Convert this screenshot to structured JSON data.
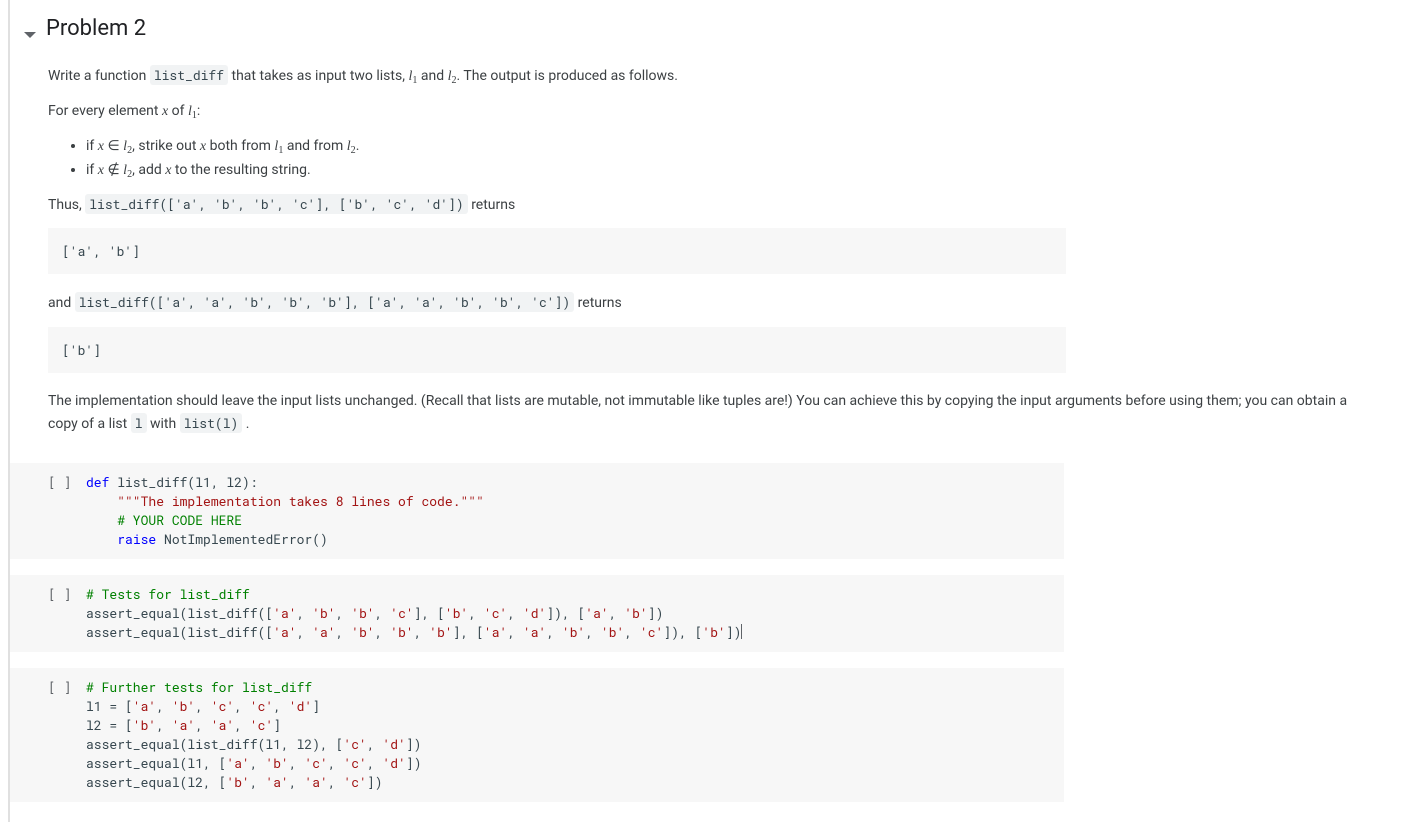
{
  "heading": "Problem 2",
  "para1_pre": "Write a function ",
  "para1_code": "list_diff",
  "para1_mid": " that takes as input two lists, ",
  "para1_l1": "l",
  "para1_l1_sub": "1",
  "para1_and": " and ",
  "para1_l2": "l",
  "para1_l2_sub": "2",
  "para1_end": ". The output is produced as follows.",
  "para2_pre": "For every element ",
  "para2_x": "x",
  "para2_mid": " of ",
  "para2_l1": "l",
  "para2_l1_sub": "1",
  "para2_end": ":",
  "li1_pre": "if ",
  "li1_x": "x",
  "li1_in": " ∈ ",
  "li1_l2": "l",
  "li1_l2_sub": "2",
  "li1_mid": ", strike out ",
  "li1_x2": "x",
  "li1_from": " both from ",
  "li1_l1": "l",
  "li1_l1_sub": "1",
  "li1_and": " and from ",
  "li1_l2b": "l",
  "li1_l2b_sub": "2",
  "li1_end": ".",
  "li2_pre": "if ",
  "li2_x": "x",
  "li2_nin": " ∉ ",
  "li2_l2": "l",
  "li2_l2_sub": "2",
  "li2_mid": ", add ",
  "li2_x2": "x",
  "li2_end": " to the resulting string.",
  "para3_pre": "Thus, ",
  "para3_code": "list_diff(['a', 'b', 'b', 'c'], ['b', 'c', 'd'])",
  "para3_end": " returns",
  "codeblock1": "['a', 'b']",
  "para4_pre": "and ",
  "para4_code": "list_diff(['a', 'a', 'b', 'b', 'b'], ['a', 'a', 'b', 'b', 'c'])",
  "para4_end": " returns",
  "codeblock2": "['b']",
  "para5_pre": "The implementation should leave the input lists unchanged. (Recall that lists are mutable, not immutable like tuples are!) You can achieve this by copying the input arguments before using them; you can obtain a copy of a list ",
  "para5_code1": "l",
  "para5_mid": " with ",
  "para5_code2": "list(l)",
  "para5_end": " .",
  "cell_prompt": "[ ]",
  "cell1_l1_a": "def",
  "cell1_l1_b": " list_diff(l1, l2):",
  "cell1_l2": "    \"\"\"The implementation takes 8 lines of code.\"\"\"",
  "cell1_l3": "    # YOUR CODE HERE",
  "cell1_l4_a": "    ",
  "cell1_l4_b": "raise",
  "cell1_l4_c": " NotImplementedError()",
  "cell2_l1": "# Tests for list_diff",
  "cell2_l2_a": "assert_equal(list_diff([",
  "cell2_l2_b": "'a'",
  "cell2_l2_c": ", ",
  "cell2_l2_d": "'b'",
  "cell2_l2_e": ", ",
  "cell2_l2_f": "'b'",
  "cell2_l2_g": ", ",
  "cell2_l2_h": "'c'",
  "cell2_l2_i": "], [",
  "cell2_l2_j": "'b'",
  "cell2_l2_k": ", ",
  "cell2_l2_l": "'c'",
  "cell2_l2_m": ", ",
  "cell2_l2_n": "'d'",
  "cell2_l2_o": "]), [",
  "cell2_l2_p": "'a'",
  "cell2_l2_q": ", ",
  "cell2_l2_r": "'b'",
  "cell2_l2_s": "])",
  "cell2_l3_a": "assert_equal(list_diff([",
  "cell2_l3_b": "'a'",
  "cell2_l3_c": ", ",
  "cell2_l3_d": "'a'",
  "cell2_l3_e": ", ",
  "cell2_l3_f": "'b'",
  "cell2_l3_g": ", ",
  "cell2_l3_h": "'b'",
  "cell2_l3_i": ", ",
  "cell2_l3_j": "'b'",
  "cell2_l3_k": "], [",
  "cell2_l3_l": "'a'",
  "cell2_l3_m": ", ",
  "cell2_l3_n": "'a'",
  "cell2_l3_o": ", ",
  "cell2_l3_p": "'b'",
  "cell2_l3_q": ", ",
  "cell2_l3_r": "'b'",
  "cell2_l3_s": ", ",
  "cell2_l3_t": "'c'",
  "cell2_l3_u": "]), [",
  "cell2_l3_v": "'b'",
  "cell2_l3_w": "])",
  "cell3_l1": "# Further tests for list_diff",
  "cell3_l2_a": "l1 = [",
  "cell3_l2_b": "'a'",
  "cell3_l2_c": ", ",
  "cell3_l2_d": "'b'",
  "cell3_l2_e": ", ",
  "cell3_l2_f": "'c'",
  "cell3_l2_g": ", ",
  "cell3_l2_h": "'c'",
  "cell3_l2_i": ", ",
  "cell3_l2_j": "'d'",
  "cell3_l2_k": "]",
  "cell3_l3_a": "l2 = [",
  "cell3_l3_b": "'b'",
  "cell3_l3_c": ", ",
  "cell3_l3_d": "'a'",
  "cell3_l3_e": ", ",
  "cell3_l3_f": "'a'",
  "cell3_l3_g": ", ",
  "cell3_l3_h": "'c'",
  "cell3_l3_i": "]",
  "cell3_l4_a": "assert_equal(list_diff(l1, l2), [",
  "cell3_l4_b": "'c'",
  "cell3_l4_c": ", ",
  "cell3_l4_d": "'d'",
  "cell3_l4_e": "])",
  "cell3_l5_a": "assert_equal(l1, [",
  "cell3_l5_b": "'a'",
  "cell3_l5_c": ", ",
  "cell3_l5_d": "'b'",
  "cell3_l5_e": ", ",
  "cell3_l5_f": "'c'",
  "cell3_l5_g": ", ",
  "cell3_l5_h": "'c'",
  "cell3_l5_i": ", ",
  "cell3_l5_j": "'d'",
  "cell3_l5_k": "])",
  "cell3_l6_a": "assert_equal(l2, [",
  "cell3_l6_b": "'b'",
  "cell3_l6_c": ", ",
  "cell3_l6_d": "'a'",
  "cell3_l6_e": ", ",
  "cell3_l6_f": "'a'",
  "cell3_l6_g": ", ",
  "cell3_l6_h": "'c'",
  "cell3_l6_i": "])"
}
